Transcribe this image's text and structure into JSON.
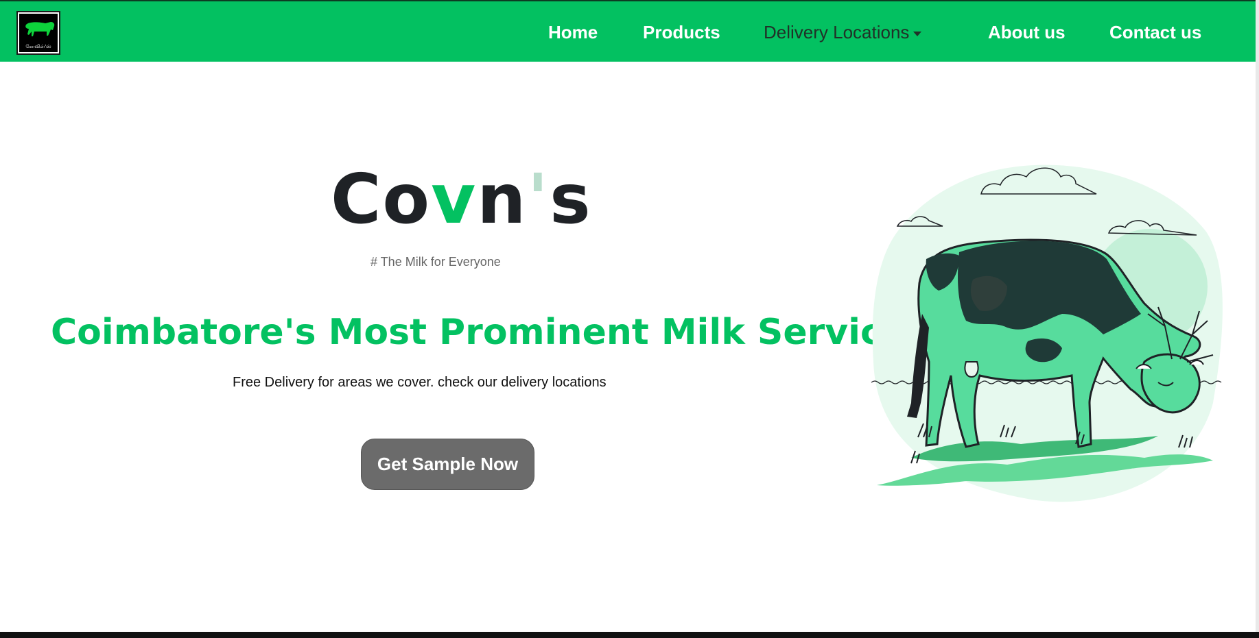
{
  "brand": {
    "logo_caption": "கோவின்'ஸ்",
    "name_part1": "Co",
    "name_v": "v",
    "name_part2": "n",
    "name_apos": "'",
    "name_part3": "s",
    "tagline": "# The Milk for Everyone"
  },
  "nav": {
    "home": "Home",
    "products": "Products",
    "delivery": "Delivery Locations",
    "about": "About us",
    "contact": "Contact us"
  },
  "hero": {
    "headline": "Coimbatore's Most Prominent Milk Service",
    "subtext": "Free Delivery for areas we cover. check our delivery locations",
    "cta": "Get Sample Now"
  },
  "colors": {
    "accent": "#03c161",
    "nav_bg": "#03c161",
    "button_bg": "#6b6b6b",
    "dark_text": "#1f2226"
  },
  "icons": {
    "logo": "cow-logo-icon",
    "dropdown": "caret-down-icon",
    "illustration": "grazing-cow-illustration"
  }
}
